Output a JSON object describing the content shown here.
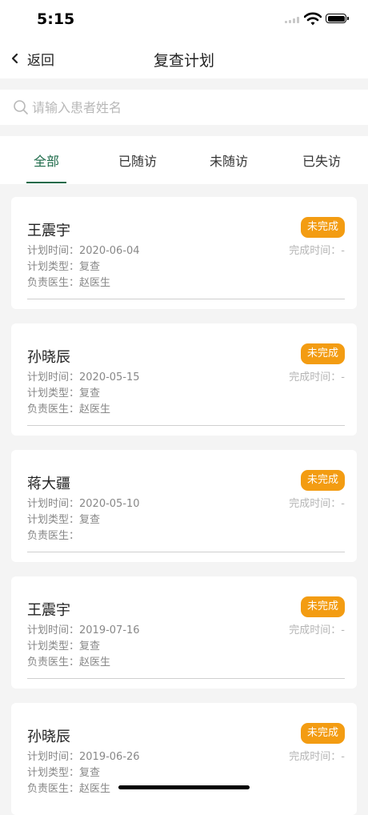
{
  "status_bar": {
    "time": "5:15"
  },
  "nav": {
    "back_label": "返回",
    "title": "复查计划"
  },
  "search": {
    "placeholder": "请输入患者姓名",
    "value": ""
  },
  "tabs": [
    {
      "label": "全部",
      "active": true
    },
    {
      "label": "已随访",
      "active": false
    },
    {
      "label": "未随访",
      "active": false
    },
    {
      "label": "已失访",
      "active": false
    }
  ],
  "labels": {
    "plan_time": "计划时间：",
    "plan_type": "计划类型：",
    "doctor": "负责医生：",
    "complete_time": "完成时间：-"
  },
  "colors": {
    "accent": "#1e6b4a",
    "status_badge": "#f39c12",
    "background": "#f4f4f4"
  },
  "records": [
    {
      "name": "王震宇",
      "status": "未完成",
      "plan_time": "2020-06-04",
      "plan_type": "复查",
      "doctor": "赵医生"
    },
    {
      "name": "孙晓辰",
      "status": "未完成",
      "plan_time": "2020-05-15",
      "plan_type": "复查",
      "doctor": "赵医生"
    },
    {
      "name": "蒋大疆",
      "status": "未完成",
      "plan_time": "2020-05-10",
      "plan_type": "复查",
      "doctor": ""
    },
    {
      "name": "王震宇",
      "status": "未完成",
      "plan_time": "2019-07-16",
      "plan_type": "复查",
      "doctor": "赵医生"
    },
    {
      "name": "孙晓辰",
      "status": "未完成",
      "plan_time": "2019-06-26",
      "plan_type": "复查",
      "doctor": "赵医生"
    }
  ]
}
